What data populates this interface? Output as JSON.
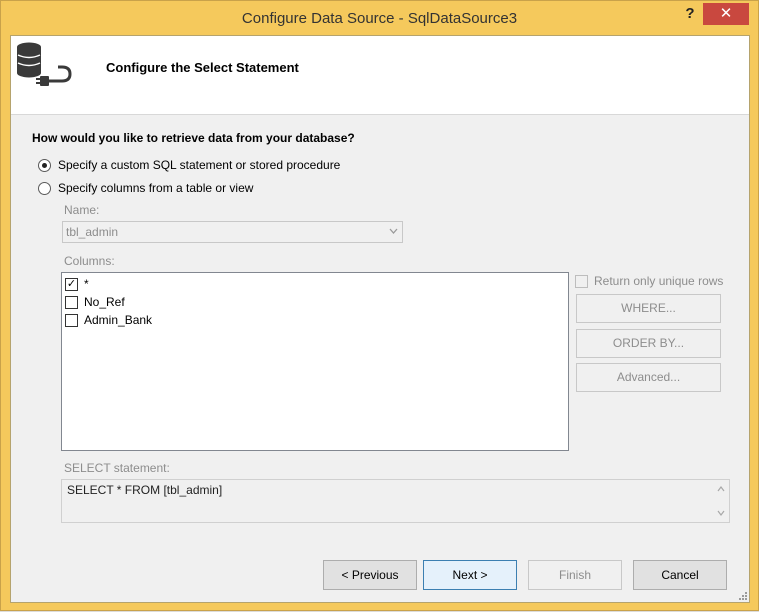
{
  "window": {
    "title": "Configure Data Source - SqlDataSource3",
    "help_label": "?",
    "close_label": "✕"
  },
  "header": {
    "title": "Configure the Select Statement",
    "icon": "database-plug-icon"
  },
  "question": "How would you like to retrieve data from your database?",
  "options": [
    {
      "label": "Specify a custom SQL statement or stored procedure",
      "checked": true
    },
    {
      "label": "Specify columns from a table or view",
      "checked": false
    }
  ],
  "name_section": {
    "label": "Name:",
    "value": "tbl_admin"
  },
  "columns_section": {
    "label": "Columns:",
    "items": [
      {
        "label": "*",
        "checked": true
      },
      {
        "label": "No_Ref",
        "checked": false
      },
      {
        "label": "Admin_Bank",
        "checked": false
      }
    ]
  },
  "side_panel": {
    "unique_rows_label": "Return only unique rows",
    "where_label": "WHERE...",
    "order_by_label": "ORDER BY...",
    "advanced_label": "Advanced..."
  },
  "select_statement": {
    "label": "SELECT statement:",
    "value": "SELECT * FROM [tbl_admin]"
  },
  "footer": {
    "previous_label": "< Previous",
    "next_label": "Next >",
    "finish_label": "Finish",
    "cancel_label": "Cancel"
  },
  "colors": {
    "frame": "#f5c95c",
    "close": "#c9483f",
    "disabled_text": "#8d8d8d"
  }
}
